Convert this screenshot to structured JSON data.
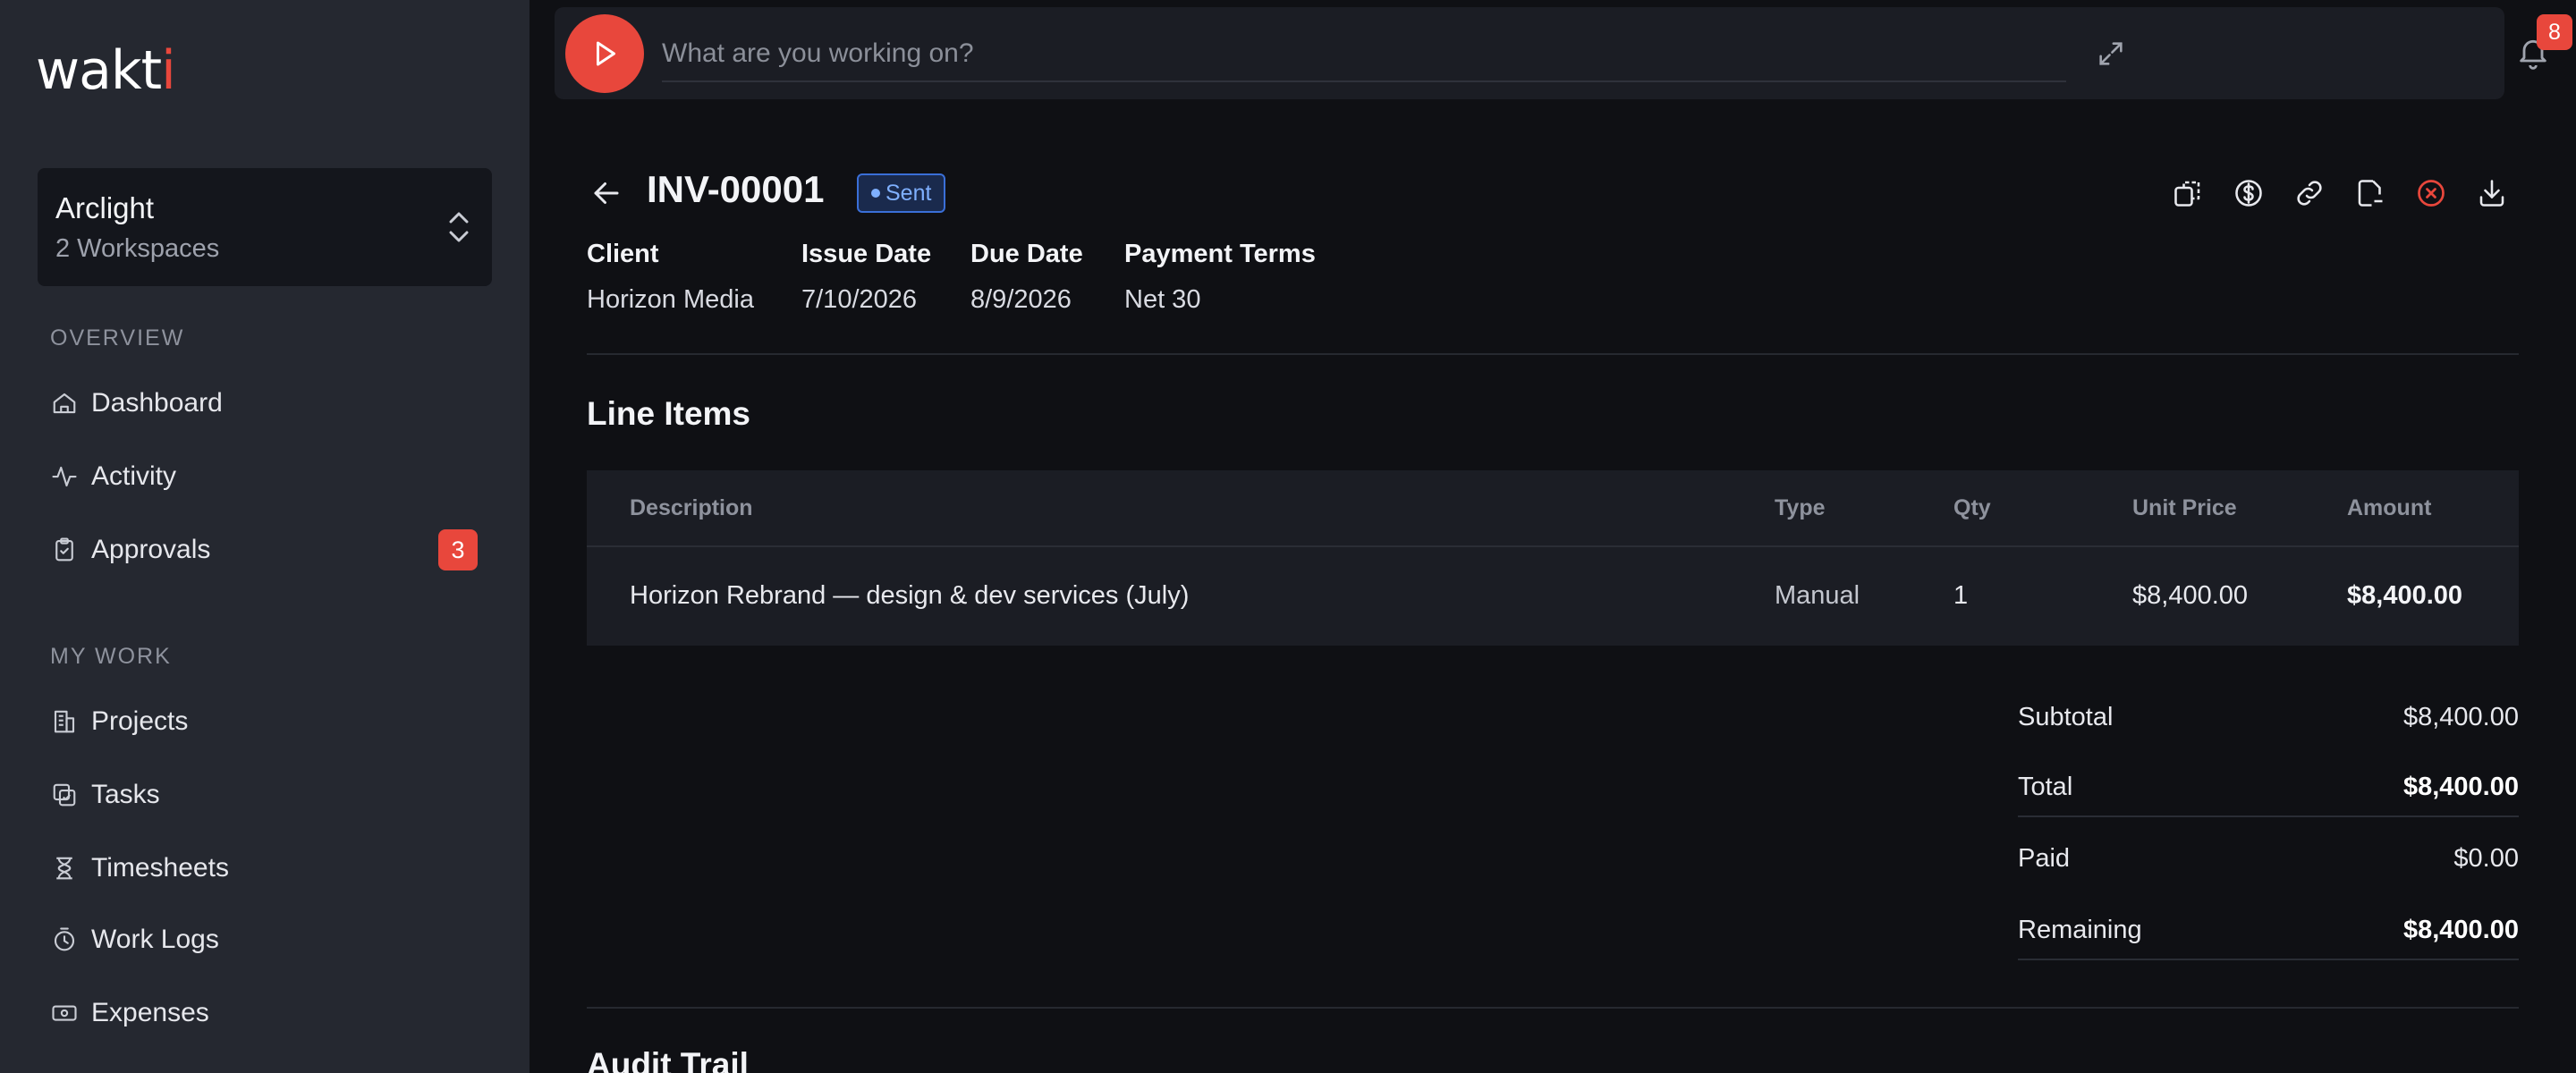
{
  "app": {
    "logo_text": "wakti"
  },
  "workspace": {
    "name": "Arclight",
    "sub": "2 Workspaces"
  },
  "sidebar": {
    "overview_label": "OVERVIEW",
    "overview_items": [
      {
        "label": "Dashboard",
        "icon": "home-icon"
      },
      {
        "label": "Activity",
        "icon": "activity-icon"
      },
      {
        "label": "Approvals",
        "icon": "clipboard-check-icon",
        "badge": "3"
      }
    ],
    "mywork_label": "MY WORK",
    "mywork_items": [
      {
        "label": "Projects",
        "icon": "building-icon"
      },
      {
        "label": "Tasks",
        "icon": "tasks-icon"
      },
      {
        "label": "Timesheets",
        "icon": "hourglass-icon"
      },
      {
        "label": "Work Logs",
        "icon": "clock-icon"
      },
      {
        "label": "Expenses",
        "icon": "banknote-icon"
      }
    ]
  },
  "topbar": {
    "timer_placeholder": "What are you working on?",
    "notifications_count": "8"
  },
  "invoice": {
    "number": "INV-00001",
    "status": "Sent",
    "meta": [
      {
        "label": "Client",
        "value": "Horizon Media"
      },
      {
        "label": "Issue Date",
        "value": "7/10/2026"
      },
      {
        "label": "Due Date",
        "value": "8/9/2026"
      },
      {
        "label": "Payment Terms",
        "value": "Net 30"
      }
    ]
  },
  "line_items": {
    "title": "Line Items",
    "columns": [
      "Description",
      "Type",
      "Qty",
      "Unit Price",
      "Amount"
    ],
    "rows": [
      [
        "Horizon Rebrand — design & dev services (July)",
        "Manual",
        "1",
        "$8,400.00",
        "$8,400.00"
      ]
    ]
  },
  "totals": {
    "subtotal_label": "Subtotal",
    "subtotal": "$8,400.00",
    "total_label": "Total",
    "total": "$8,400.00",
    "paid_label": "Paid",
    "paid": "$0.00",
    "remaining_label": "Remaining",
    "remaining": "$8,400.00"
  },
  "audit": {
    "title": "Audit Trail"
  },
  "colors": {
    "accent": "#e8473c",
    "status_blue": "#7fb0ff"
  }
}
